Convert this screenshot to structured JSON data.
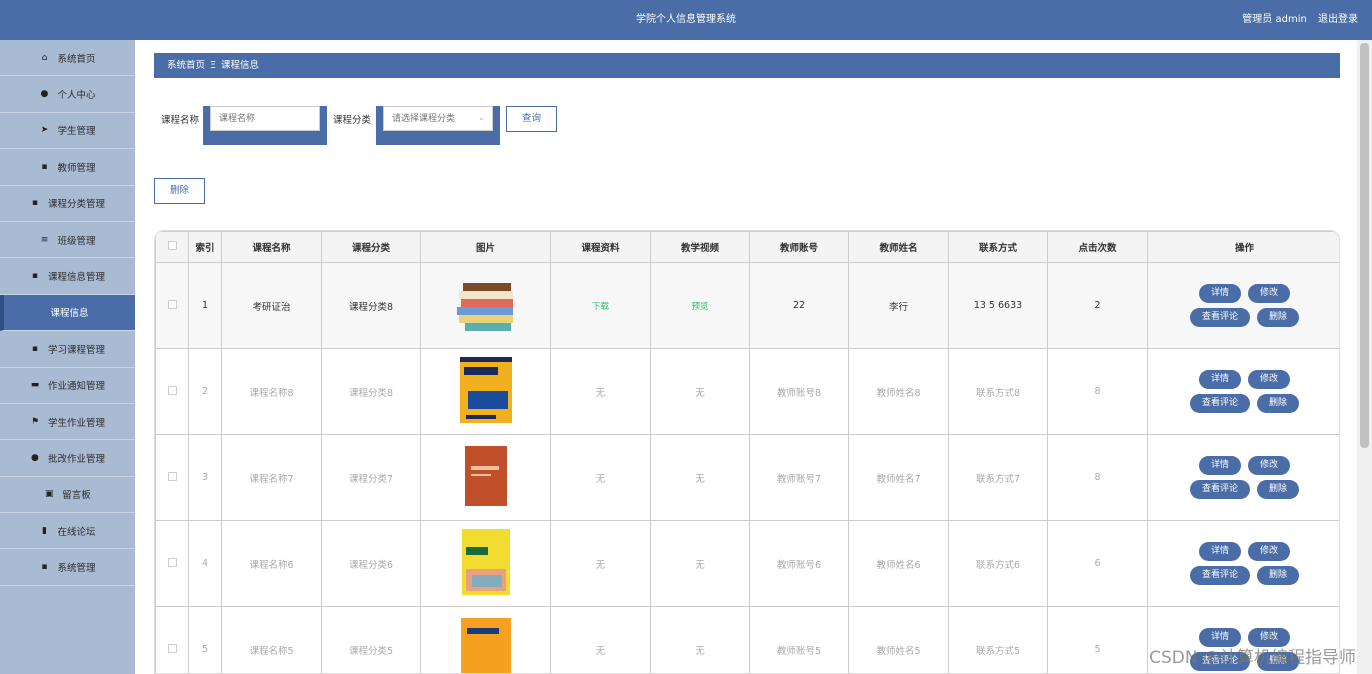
{
  "header": {
    "title": "学院个人信息管理系统",
    "user": "管理员 admin",
    "logout": "退出登录"
  },
  "sidebar": {
    "items": [
      {
        "label": "系统首页",
        "icon": "home-icon"
      },
      {
        "label": "个人中心",
        "icon": "user-icon"
      },
      {
        "label": "学生管理",
        "icon": "send-icon"
      },
      {
        "label": "教师管理",
        "icon": "grid-icon"
      },
      {
        "label": "课程分类管理",
        "icon": "grid-icon"
      },
      {
        "label": "班级管理",
        "icon": "list-icon"
      },
      {
        "label": "课程信息管理",
        "icon": "grid-icon"
      },
      {
        "label": "课程信息",
        "icon": ""
      },
      {
        "label": "学习课程管理",
        "icon": "grid-icon"
      },
      {
        "label": "作业通知管理",
        "icon": "book-icon"
      },
      {
        "label": "学生作业管理",
        "icon": "flag-icon"
      },
      {
        "label": "批改作业管理",
        "icon": "pin-icon"
      },
      {
        "label": "留言板",
        "icon": "trash-icon"
      },
      {
        "label": "在线论坛",
        "icon": "library-icon"
      },
      {
        "label": "系统管理",
        "icon": "grid-icon"
      }
    ]
  },
  "breadcrumb": {
    "home": "系统首页",
    "sep": "Ξ",
    "current": "课程信息"
  },
  "search": {
    "name_label": "课程名称",
    "name_placeholder": "课程名称",
    "category_label": "课程分类",
    "category_placeholder": "请选择课程分类",
    "query_button": "查询",
    "delete_button": "删除"
  },
  "table": {
    "headers": [
      "索引",
      "课程名称",
      "课程分类",
      "图片",
      "课程资料",
      "教学视频",
      "教师账号",
      "教师姓名",
      "联系方式",
      "点击次数",
      "操作"
    ],
    "rows": [
      {
        "index": "1",
        "name": "考研证治",
        "category": "课程分类8",
        "material": "下载",
        "video": "预览",
        "account": "22",
        "teacher": "李行",
        "contact": "13  5  6633",
        "clicks": "2"
      },
      {
        "index": "2",
        "name": "课程名称8",
        "category": "课程分类8",
        "material": "无",
        "video": "无",
        "account": "教师账号8",
        "teacher": "教师姓名8",
        "contact": "联系方式8",
        "clicks": "8"
      },
      {
        "index": "3",
        "name": "课程名称7",
        "category": "课程分类7",
        "material": "无",
        "video": "无",
        "account": "教师账号7",
        "teacher": "教师姓名7",
        "contact": "联系方式7",
        "clicks": "8"
      },
      {
        "index": "4",
        "name": "课程名称6",
        "category": "课程分类6",
        "material": "无",
        "video": "无",
        "account": "教师账号6",
        "teacher": "教师姓名6",
        "contact": "联系方式6",
        "clicks": "6"
      },
      {
        "index": "5",
        "name": "课程名称5",
        "category": "课程分类5",
        "material": "无",
        "video": "无",
        "account": "教师账号5",
        "teacher": "教师姓名5",
        "contact": "联系方式5",
        "clicks": "5"
      }
    ],
    "actions": {
      "detail": "详情",
      "edit": "修改",
      "comments": "查看评论",
      "delete": "删除"
    }
  },
  "watermark": "CSDN @计算机编程指导师",
  "colors": {
    "primary": "#4a6da7",
    "sidebar": "#a9bad3",
    "link": "#2bbf6a"
  }
}
